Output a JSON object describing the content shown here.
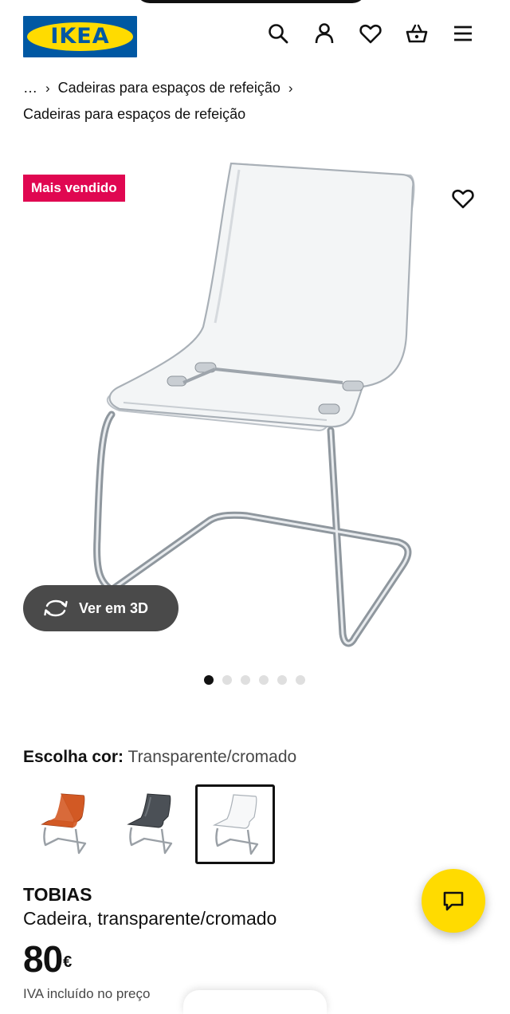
{
  "header": {
    "logo_text": "IKEA",
    "icons": [
      "search-icon",
      "user-icon",
      "heart-icon",
      "basket-icon",
      "menu-icon"
    ]
  },
  "breadcrumb": {
    "ellipsis": "…",
    "items": [
      "Cadeiras para espaços de refeição"
    ],
    "current": "Cadeiras para espaços de refeição"
  },
  "gallery": {
    "badge": "Mais vendido",
    "view_3d_label": "Ver em 3D",
    "image_count": 6,
    "active_index": 0
  },
  "color_chooser": {
    "label": "Escolha cor:",
    "selected_value": "Transparente/cromado",
    "options": [
      "laranja",
      "cinzento",
      "transparente"
    ]
  },
  "product": {
    "name": "TOBIAS",
    "description": "Cadeira, transparente/cromado",
    "price": "80",
    "currency": "€",
    "vat_note": "IVA incluído no preço"
  },
  "colors": {
    "brand_blue": "#0058a3",
    "brand_yellow": "#ffdb00",
    "badge_red": "#e00751"
  }
}
